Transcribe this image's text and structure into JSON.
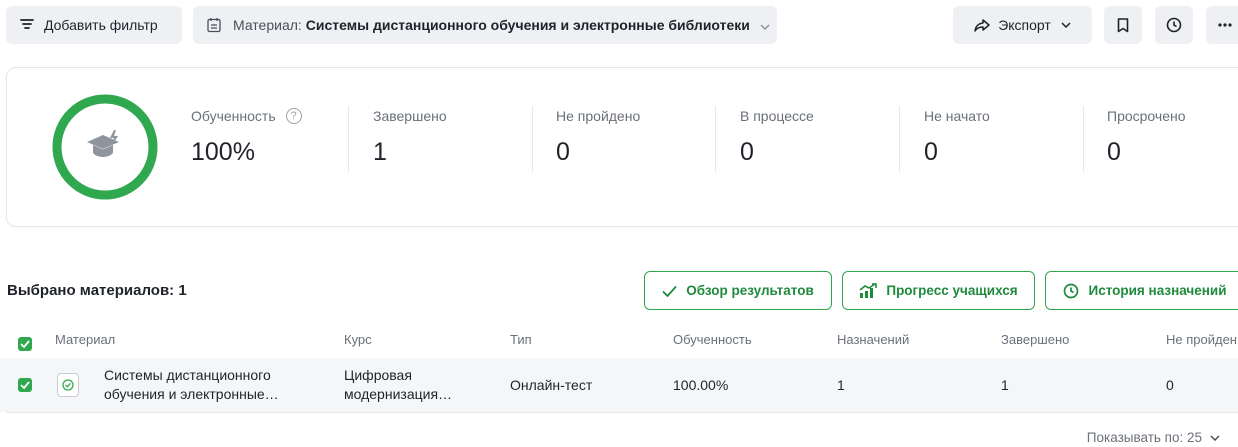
{
  "toolbar": {
    "add_filter_label": "Добавить фильтр",
    "material_filter_key": "Материал:",
    "material_filter_value": "Системы дистанционного обучения и электронные библиотеки",
    "export_label": "Экспорт"
  },
  "stats": {
    "progress_value": 1.0,
    "learning_label": "Обученность",
    "learning_value": "100%",
    "completed_label": "Завершено",
    "completed_value": "1",
    "failed_label": "Не пройдено",
    "failed_value": "0",
    "in_progress_label": "В процессе",
    "in_progress_value": "0",
    "not_started_label": "Не начато",
    "not_started_value": "0",
    "overdue_label": "Просрочено",
    "overdue_value": "0"
  },
  "selection": {
    "count_label": "Выбрано материалов: 1",
    "review_label": "Обзор результатов",
    "progress_label": "Прогресс учащихся",
    "history_label": "История назначений"
  },
  "table": {
    "columns": [
      "Материал",
      "Курс",
      "Тип",
      "Обученность",
      "Назначений",
      "Завершено",
      "Не пройден"
    ],
    "rows": [
      {
        "material_line1": "Системы дистанционного",
        "material_line2": "обучения и электронные…",
        "course_line1": "Цифровая",
        "course_line2": "модернизация…",
        "type": "Онлайн-тест",
        "learning": "100.00%",
        "assigned": "1",
        "completed": "1",
        "failed": "0"
      }
    ]
  },
  "pagination": {
    "page_size_label": "Показывать по: 25"
  },
  "colors": {
    "accent": "#2fa84f",
    "accent_text": "#1f8a3c",
    "button_bg": "#eef0f3"
  }
}
